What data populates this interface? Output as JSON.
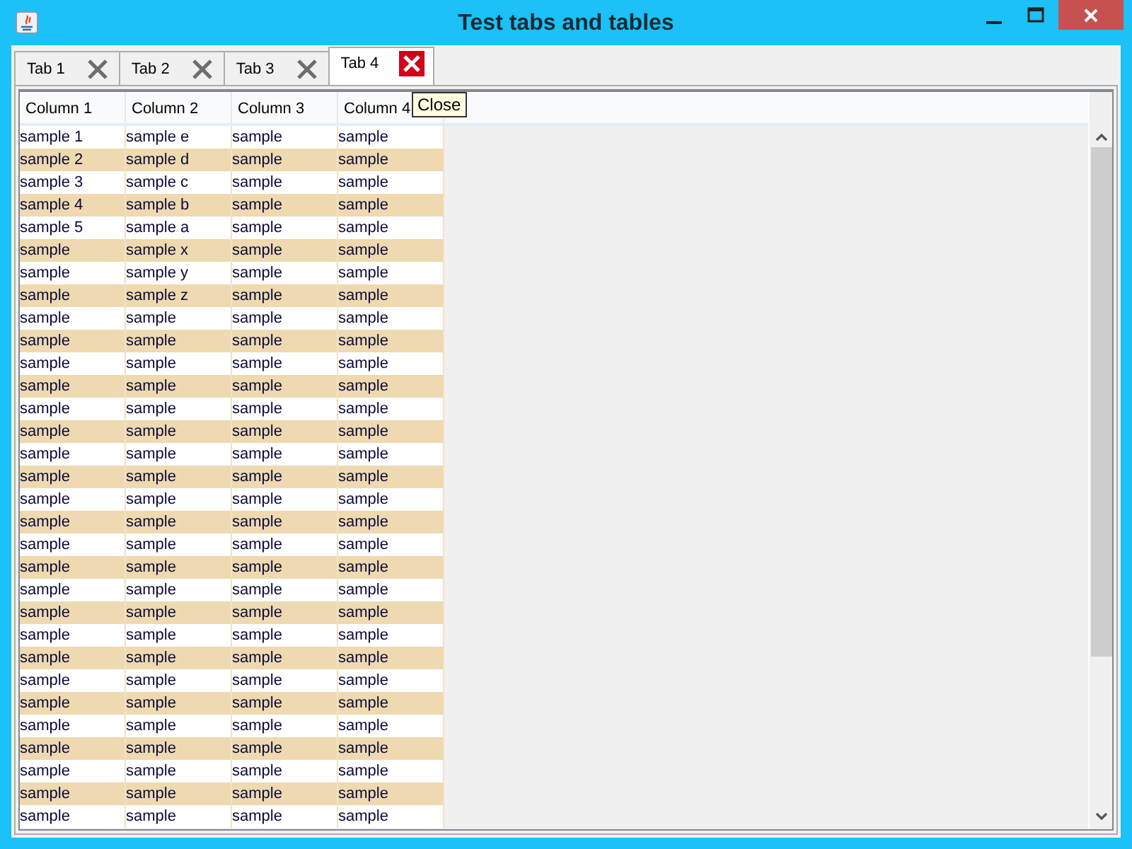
{
  "window": {
    "title": "Test tabs and tables"
  },
  "tabs": [
    {
      "label": "Tab 1",
      "selected": false,
      "close_hovered": false
    },
    {
      "label": "Tab 2",
      "selected": false,
      "close_hovered": false
    },
    {
      "label": "Tab 3",
      "selected": false,
      "close_hovered": false
    },
    {
      "label": "Tab 4",
      "selected": true,
      "close_hovered": true
    }
  ],
  "tooltip": "Close",
  "table": {
    "columns": [
      "Column 1",
      "Column 2",
      "Column 3",
      "Column 4"
    ],
    "rows": [
      [
        "sample 1",
        "sample e",
        "sample",
        "sample"
      ],
      [
        "sample 2",
        "sample d",
        "sample",
        "sample"
      ],
      [
        "sample 3",
        "sample c",
        "sample",
        "sample"
      ],
      [
        "sample 4",
        "sample b",
        "sample",
        "sample"
      ],
      [
        "sample 5",
        "sample a",
        "sample",
        "sample"
      ],
      [
        "sample",
        "sample x",
        "sample",
        "sample"
      ],
      [
        "sample",
        "sample y",
        "sample",
        "sample"
      ],
      [
        "sample",
        "sample z",
        "sample",
        "sample"
      ],
      [
        "sample",
        "sample",
        "sample",
        "sample"
      ],
      [
        "sample",
        "sample",
        "sample",
        "sample"
      ],
      [
        "sample",
        "sample",
        "sample",
        "sample"
      ],
      [
        "sample",
        "sample",
        "sample",
        "sample"
      ],
      [
        "sample",
        "sample",
        "sample",
        "sample"
      ],
      [
        "sample",
        "sample",
        "sample",
        "sample"
      ],
      [
        "sample",
        "sample",
        "sample",
        "sample"
      ],
      [
        "sample",
        "sample",
        "sample",
        "sample"
      ],
      [
        "sample",
        "sample",
        "sample",
        "sample"
      ],
      [
        "sample",
        "sample",
        "sample",
        "sample"
      ],
      [
        "sample",
        "sample",
        "sample",
        "sample"
      ],
      [
        "sample",
        "sample",
        "sample",
        "sample"
      ],
      [
        "sample",
        "sample",
        "sample",
        "sample"
      ],
      [
        "sample",
        "sample",
        "sample",
        "sample"
      ],
      [
        "sample",
        "sample",
        "sample",
        "sample"
      ],
      [
        "sample",
        "sample",
        "sample",
        "sample"
      ],
      [
        "sample",
        "sample",
        "sample",
        "sample"
      ],
      [
        "sample",
        "sample",
        "sample",
        "sample"
      ],
      [
        "sample",
        "sample",
        "sample",
        "sample"
      ],
      [
        "sample",
        "sample",
        "sample",
        "sample"
      ],
      [
        "sample",
        "sample",
        "sample",
        "sample"
      ],
      [
        "sample",
        "sample",
        "sample",
        "sample"
      ],
      [
        "sample",
        "sample",
        "sample",
        "sample"
      ]
    ]
  }
}
